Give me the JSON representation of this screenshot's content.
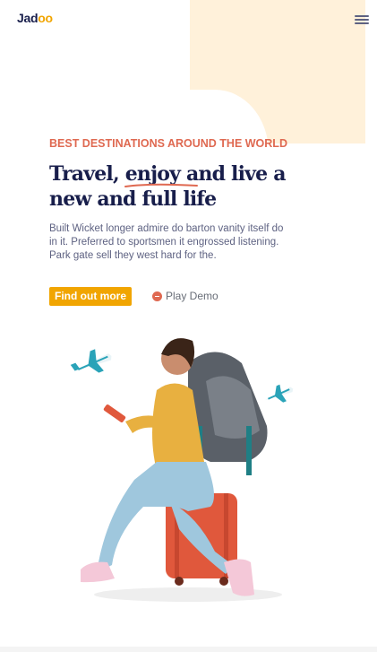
{
  "header": {
    "logo_prefix": "Jad",
    "logo_suffix": "oo",
    "menu_icon": "hamburger-menu-icon"
  },
  "hero": {
    "tagline": "BEST DESTINATIONS AROUND THE WORLD",
    "headline_part1": "Travel, ",
    "headline_highlight": "enjoy",
    "headline_part2": " and live a new and full life",
    "description": "Built Wicket longer admire do barton vanity itself do in it. Preferred to sportsmen it engrossed listening. Park gate sell they west hard for the.",
    "cta_label": "Find out more",
    "play_label": "Play Demo",
    "play_icon": "play-circle-icon",
    "illustration": "traveler-with-backpack-on-suitcase-illustration"
  },
  "colors": {
    "brand_dark": "#181e4b",
    "accent_orange": "#df6951",
    "accent_yellow": "#f1a501",
    "blob": "#fff1da",
    "text_muted": "#5e6282"
  }
}
